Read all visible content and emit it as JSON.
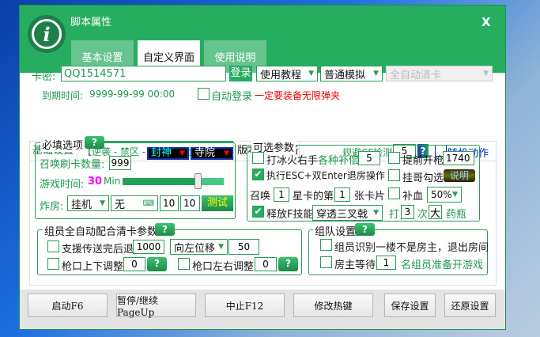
{
  "window": {
    "title": "脚本属性",
    "close": "X",
    "tabs": [
      "基本设置",
      "自定义界面",
      "使用说明"
    ],
    "active_tab": 1
  },
  "login": {
    "card_label": "卡密:",
    "card_value": "QQ1514571",
    "login_button": "登录",
    "select1": "使用教程",
    "select2": "普通模拟",
    "select3": "全自动清卡",
    "expiry_label": "到期时间:",
    "expiry_value": "9999-99-99 00:00",
    "auto_login": "自动登录",
    "warning": "一定要装备无限弹夹"
  },
  "inner_tabs": {
    "tabs": [
      "基础设置",
      "【逆袭 - 禁区 - 封神】: 全自动清卡",
      "版本更新公告"
    ],
    "active": 1,
    "cf_label": "规避CF检测",
    "cf_value": "5",
    "help": "?",
    "random_action": "随机动作"
  },
  "required": {
    "title": "必填选项",
    "help": "?",
    "summon_count_label": "召唤刷卡数量:",
    "summon_count": "999",
    "mode_select": "封神",
    "map_select": "寺院",
    "game_time_label": "游戏时间:",
    "game_time": "30",
    "game_time_unit": "Min",
    "slider_fraction": 0.74,
    "bomb_label": "炸房:",
    "bomb_select": "挂机",
    "key_input": "无",
    "val1": "10",
    "val2": "10",
    "test_button": "测试"
  },
  "optional": {
    "title": "可选参数",
    "ice_fire": "打冰火右手",
    "compensate_label": "各种补偿",
    "compensate": "5",
    "early_fire": "提前开枪",
    "early_fire_value": "1740",
    "esc_enter": "执行ESC+双Enter退房操作",
    "esc_enter_checked": true,
    "hang_check": "挂哥勾选",
    "explain_button": "说明",
    "summon_label": "召唤",
    "star": "1",
    "star_label": "星卡的第",
    "card_no": "1",
    "card_label": "张卡片",
    "heal": "补血",
    "heal_select": "50%",
    "f_skill": "释放F技能",
    "f_skill_checked": true,
    "skill_select": "穿透三叉戟",
    "hit_label": "打",
    "hit_count": "3",
    "times_label": "次",
    "size": "大",
    "potion": "药瓶"
  },
  "member": {
    "title": "组员全自动配合清卡参数",
    "help": "?",
    "support": "支援传送完后退",
    "support_value": "1000",
    "direction": "向左位移",
    "direction_value": "50",
    "vertical": "枪口上下调整",
    "vertical_value": "0",
    "horizontal": "枪口左右调整",
    "horizontal_value": "0"
  },
  "team": {
    "title": "组队设置",
    "help": "?",
    "not_host": "组员识别一楼不是房主，退出房间",
    "host_wait": "房主等待",
    "host_wait_value": "1",
    "host_wait_suffix": "名组员准备开游戏"
  },
  "buttons": [
    "启动F6",
    "暂停/继续PageUp",
    "中止F12",
    "修改热键",
    "保存设置",
    "还原设置"
  ]
}
